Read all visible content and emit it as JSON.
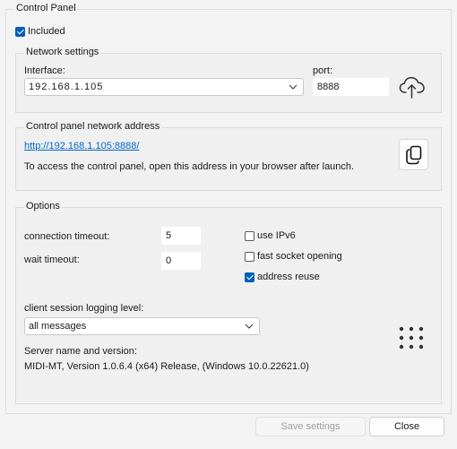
{
  "control_panel": {
    "title": "Control Panel",
    "included": {
      "label": "Included",
      "checked": true
    }
  },
  "network_settings": {
    "title": "Network settings",
    "interface_label": "Interface:",
    "interface_value": "192.168.1.105",
    "port_label": "port:",
    "port_value": "8888",
    "upload_icon": "cloud-upload-icon"
  },
  "network_address": {
    "title": "Control panel network address",
    "url": "http://192.168.1.105:8888/",
    "hint": "To access the control panel, open this address in your browser after launch.",
    "copy_icon": "copy-icon"
  },
  "options": {
    "title": "Options",
    "connection_timeout_label": "connection timeout:",
    "connection_timeout_value": "5",
    "wait_timeout_label": "wait timeout:",
    "wait_timeout_value": "0",
    "use_ipv6": {
      "label": "use IPv6",
      "checked": false
    },
    "fast_socket_opening": {
      "label": "fast socket opening",
      "checked": false
    },
    "address_reuse": {
      "label": "address reuse",
      "checked": true
    },
    "logging_level_label": "client session logging level:",
    "logging_level_value": "all messages",
    "server_label": "Server name and version:",
    "server_value": "MIDI-MT, Version 1.0.6.4 (x64) Release, (Windows 10.0.22621.0)",
    "grip_icon": "dots-grid-icon"
  },
  "buttons": {
    "save": "Save settings",
    "save_enabled": false,
    "close": "Close"
  },
  "colors": {
    "accent": "#005fb8",
    "link": "#0066cc",
    "window_background": "#f3f3f3",
    "disabled_text": "#9f9f9f"
  }
}
